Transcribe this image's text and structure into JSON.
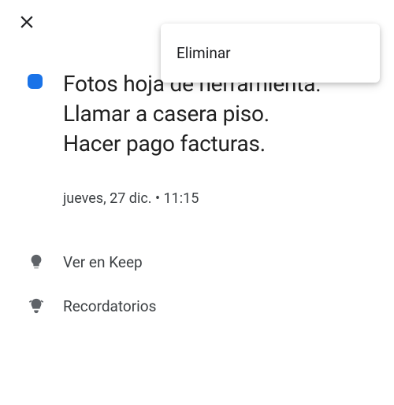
{
  "menu": {
    "delete_label": "Eliminar"
  },
  "reminder": {
    "title": "Fotos hoja de herramienta.\nLlamar a casera piso.\nHacer pago facturas.",
    "datetime": "jueves, 27 dic.  •  11:15"
  },
  "rows": {
    "keep_label": "Ver en Keep",
    "reminders_label": "Recordatorios"
  },
  "icons": {
    "close": "close-icon",
    "keep": "lightbulb-icon",
    "reminders": "reminders-icon"
  },
  "colors": {
    "accent": "#1a73e8"
  }
}
